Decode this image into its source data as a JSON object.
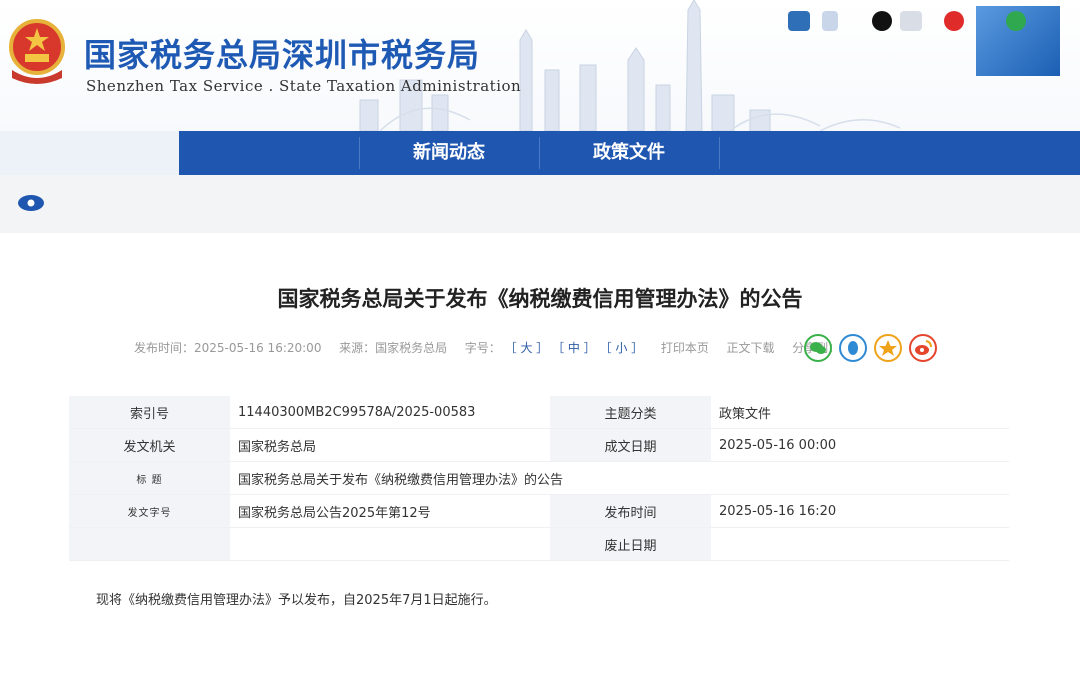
{
  "header": {
    "title": "国家税务总局深圳市税务局",
    "subtitle": "Shenzhen Tax Service . State Taxation Administration",
    "emblem_icon": "national-emblem-icon",
    "top_icons": [
      "weibo-icon",
      "app-icon",
      "douyin-icon",
      "service-icon",
      "toutiao-icon",
      "wechat-icon"
    ]
  },
  "nav": {
    "items": [
      {
        "label": "新闻动态"
      },
      {
        "label": "政策文件"
      }
    ]
  },
  "breadcrumb": {
    "icon": "location-icon"
  },
  "article": {
    "title": "国家税务总局关于发布《纳税缴费信用管理办法》的公告",
    "meta": {
      "publish_time": "发布时间：2025-05-16 16:20:00",
      "source": "来源：国家税务总局",
      "font_size_label": "字号：",
      "size_large": "［ 大 ］",
      "size_medium": "［ 中 ］",
      "size_small": "［ 小 ］",
      "print": "打印本页",
      "download": "正文下载",
      "share_label": "分享到："
    },
    "share_icons": [
      "wechat-share-icon",
      "qq-share-icon",
      "qzone-share-icon",
      "weibo-share-icon"
    ],
    "info": {
      "row1": {
        "label_a": "索引号",
        "value_a": "11440300MB2C99578A/2025-00583",
        "label_b": "主题分类",
        "value_b": "政策文件"
      },
      "row2": {
        "label_a": "发文机关",
        "value_a": "国家税务总局",
        "label_b": "成文日期",
        "value_b": "2025-05-16 00:00"
      },
      "row3": {
        "label_a": "标 题",
        "value_a": "国家税务总局关于发布《纳税缴费信用管理办法》的公告"
      },
      "row4": {
        "label_a": "发文字号",
        "value_a": "国家税务总局公告2025年第12号",
        "label_b": "发布时间",
        "value_b": "2025-05-16 16:20"
      },
      "row5": {
        "label_b": "废止日期"
      }
    },
    "body": "现将《纳税缴费信用管理办法》予以发布，自2025年7月1日起施行。"
  },
  "colors": {
    "brand_blue": "#1e5ab4",
    "nav_blue": "#1f56b0",
    "label_bg": "#f2f4f7"
  }
}
